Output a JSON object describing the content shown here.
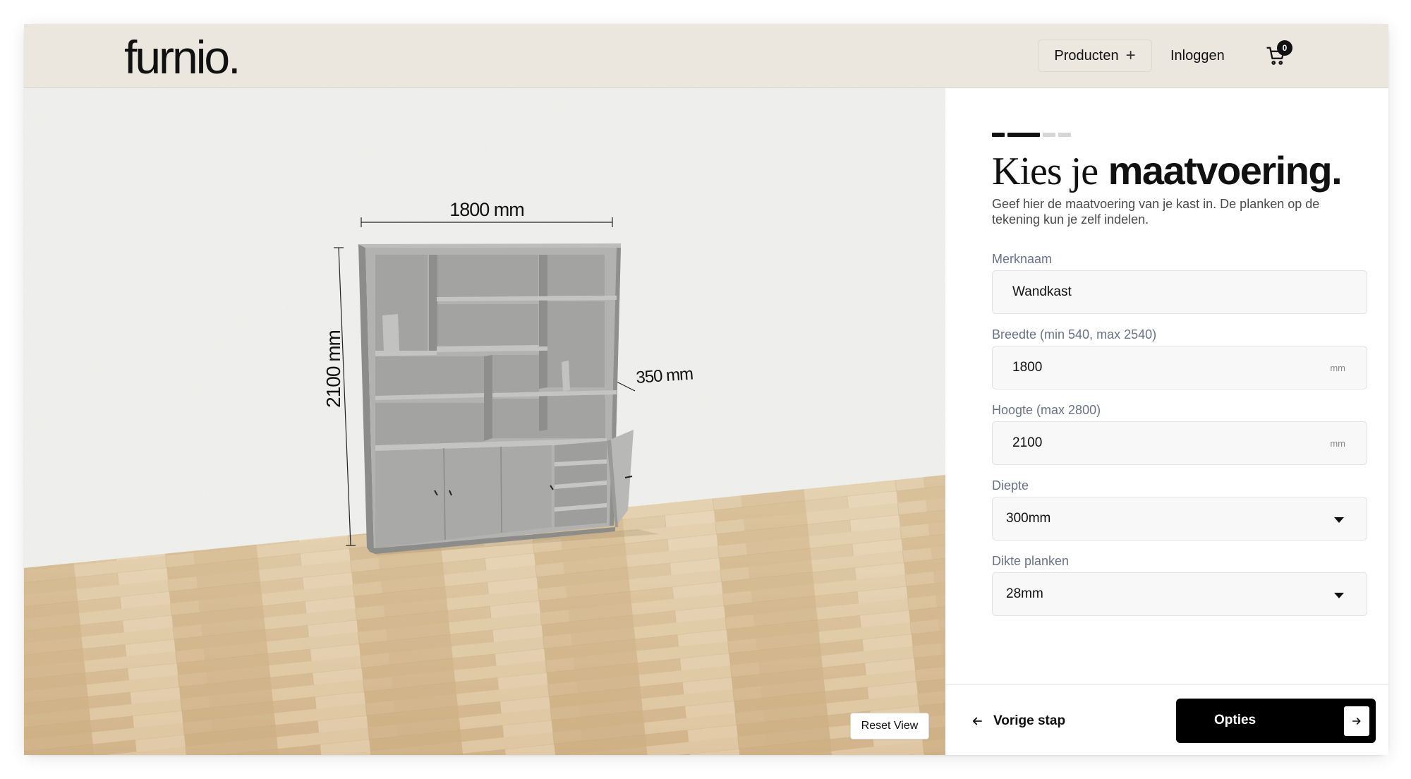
{
  "header": {
    "logo": "furnio.",
    "nav": {
      "products_label": "Producten",
      "products_icon": "plus-icon",
      "login_label": "Inloggen"
    },
    "cart": {
      "icon": "cart-icon",
      "count": "0"
    }
  },
  "viewer": {
    "dimensions": {
      "width_label": "1800 mm",
      "height_label": "2100 mm",
      "depth_label": "350 mm"
    },
    "reset_label": "Reset View"
  },
  "stepper": {
    "current": 2,
    "total": 4,
    "active_color": "#111111",
    "inactive_color": "#d6d6d6"
  },
  "panel": {
    "title_light": "Kies je",
    "title_bold": "maatvoering.",
    "subtitle": "Geef hier de maatvoering van je kast in. De planken op de tekening kun je zelf indelen.",
    "fields": [
      {
        "label": "Merknaam",
        "value": "Wandkast",
        "unit": ""
      },
      {
        "label": "Breedte (min 540, max 2540)",
        "value": "1800",
        "unit": "mm"
      },
      {
        "label": "Hoogte (max 2800)",
        "value": "2100",
        "unit": "mm"
      },
      {
        "label": "Diepte",
        "value": "300mm",
        "type": "select"
      },
      {
        "label": "Dikte planken",
        "value": "28mm",
        "type": "select"
      }
    ]
  },
  "footer": {
    "prev_label": "Vorige stap",
    "prev_icon": "arrow-left-icon",
    "next_label": "Opties",
    "next_icon": "arrow-right-icon"
  },
  "colors": {
    "header_bg": "#ebe7de",
    "wall": "#f4f4f2",
    "floor": "#dcc4a0",
    "cabinet": "#a8a8a6",
    "button": "#000000"
  }
}
